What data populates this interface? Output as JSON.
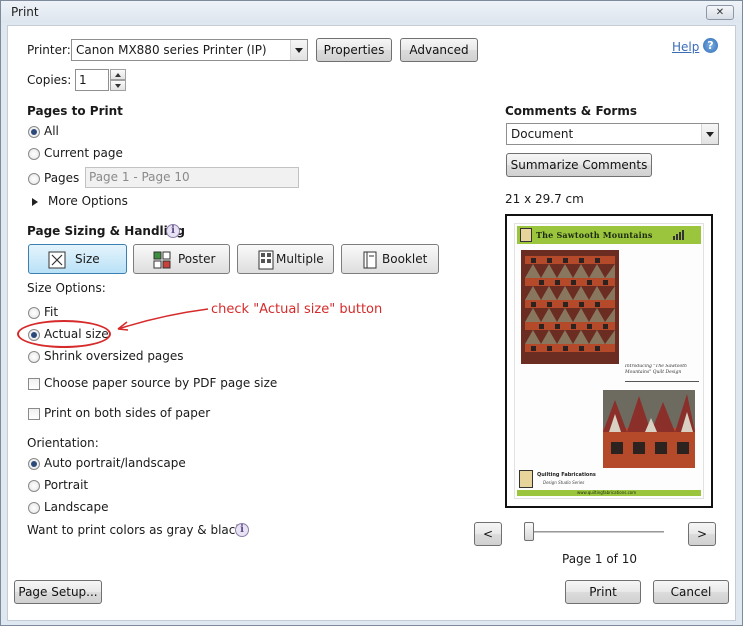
{
  "window": {
    "title": "Print",
    "close_label": "✕"
  },
  "printer": {
    "label": "Printer:",
    "selected": "Canon MX880 series Printer (IP)",
    "properties_label": "Properties",
    "advanced_label": "Advanced"
  },
  "help": {
    "label": "Help"
  },
  "copies": {
    "label": "Copies:",
    "value": "1"
  },
  "pages_to_print": {
    "heading": "Pages to Print",
    "all_label": "All",
    "current_label": "Current page",
    "pages_label": "Pages",
    "pages_value": "Page 1 - Page 10",
    "more_options_label": "More Options"
  },
  "sizing": {
    "heading": "Page Sizing & Handling",
    "tabs": [
      {
        "label": "Size"
      },
      {
        "label": "Poster"
      },
      {
        "label": "Multiple"
      },
      {
        "label": "Booklet"
      }
    ],
    "size_options_label": "Size Options:",
    "fit_label": "Fit",
    "actual_label": "Actual size",
    "shrink_label": "Shrink oversized pages",
    "choose_source_label": "Choose paper source by PDF page size",
    "both_sides_label": "Print on both sides of paper"
  },
  "annotation": {
    "text": "check \"Actual size\" button",
    "color": "#d62b2b"
  },
  "orientation": {
    "heading": "Orientation:",
    "auto_label": "Auto portrait/landscape",
    "portrait_label": "Portrait",
    "landscape_label": "Landscape"
  },
  "grayscale": {
    "label": "Want to print colors as gray & black?"
  },
  "comments": {
    "heading": "Comments & Forms",
    "selected": "Document",
    "summarize_label": "Summarize Comments"
  },
  "preview": {
    "paper_size": "21 x 29.7 cm",
    "doc_title": "The Sawtooth Mountains",
    "intro_text": "Introducing \"The Sawtooth Mountains\" Quilt Design",
    "brand_name": "Quilting Fabrications",
    "brand_tagline": "Design Studio Series",
    "footer_url": "www.quiltingfabrications.com",
    "page_status": "Page 1 of 10",
    "prev_label": "<",
    "next_label": ">",
    "slider_position": 0
  },
  "footer": {
    "page_setup_label": "Page Setup...",
    "print_label": "Print",
    "cancel_label": "Cancel"
  },
  "colors": {
    "accent": "#3c7fb1",
    "help_link": "#3a6db5",
    "doc_header_bar": "#9bc53d",
    "quilt_red": "#b54a2a"
  }
}
